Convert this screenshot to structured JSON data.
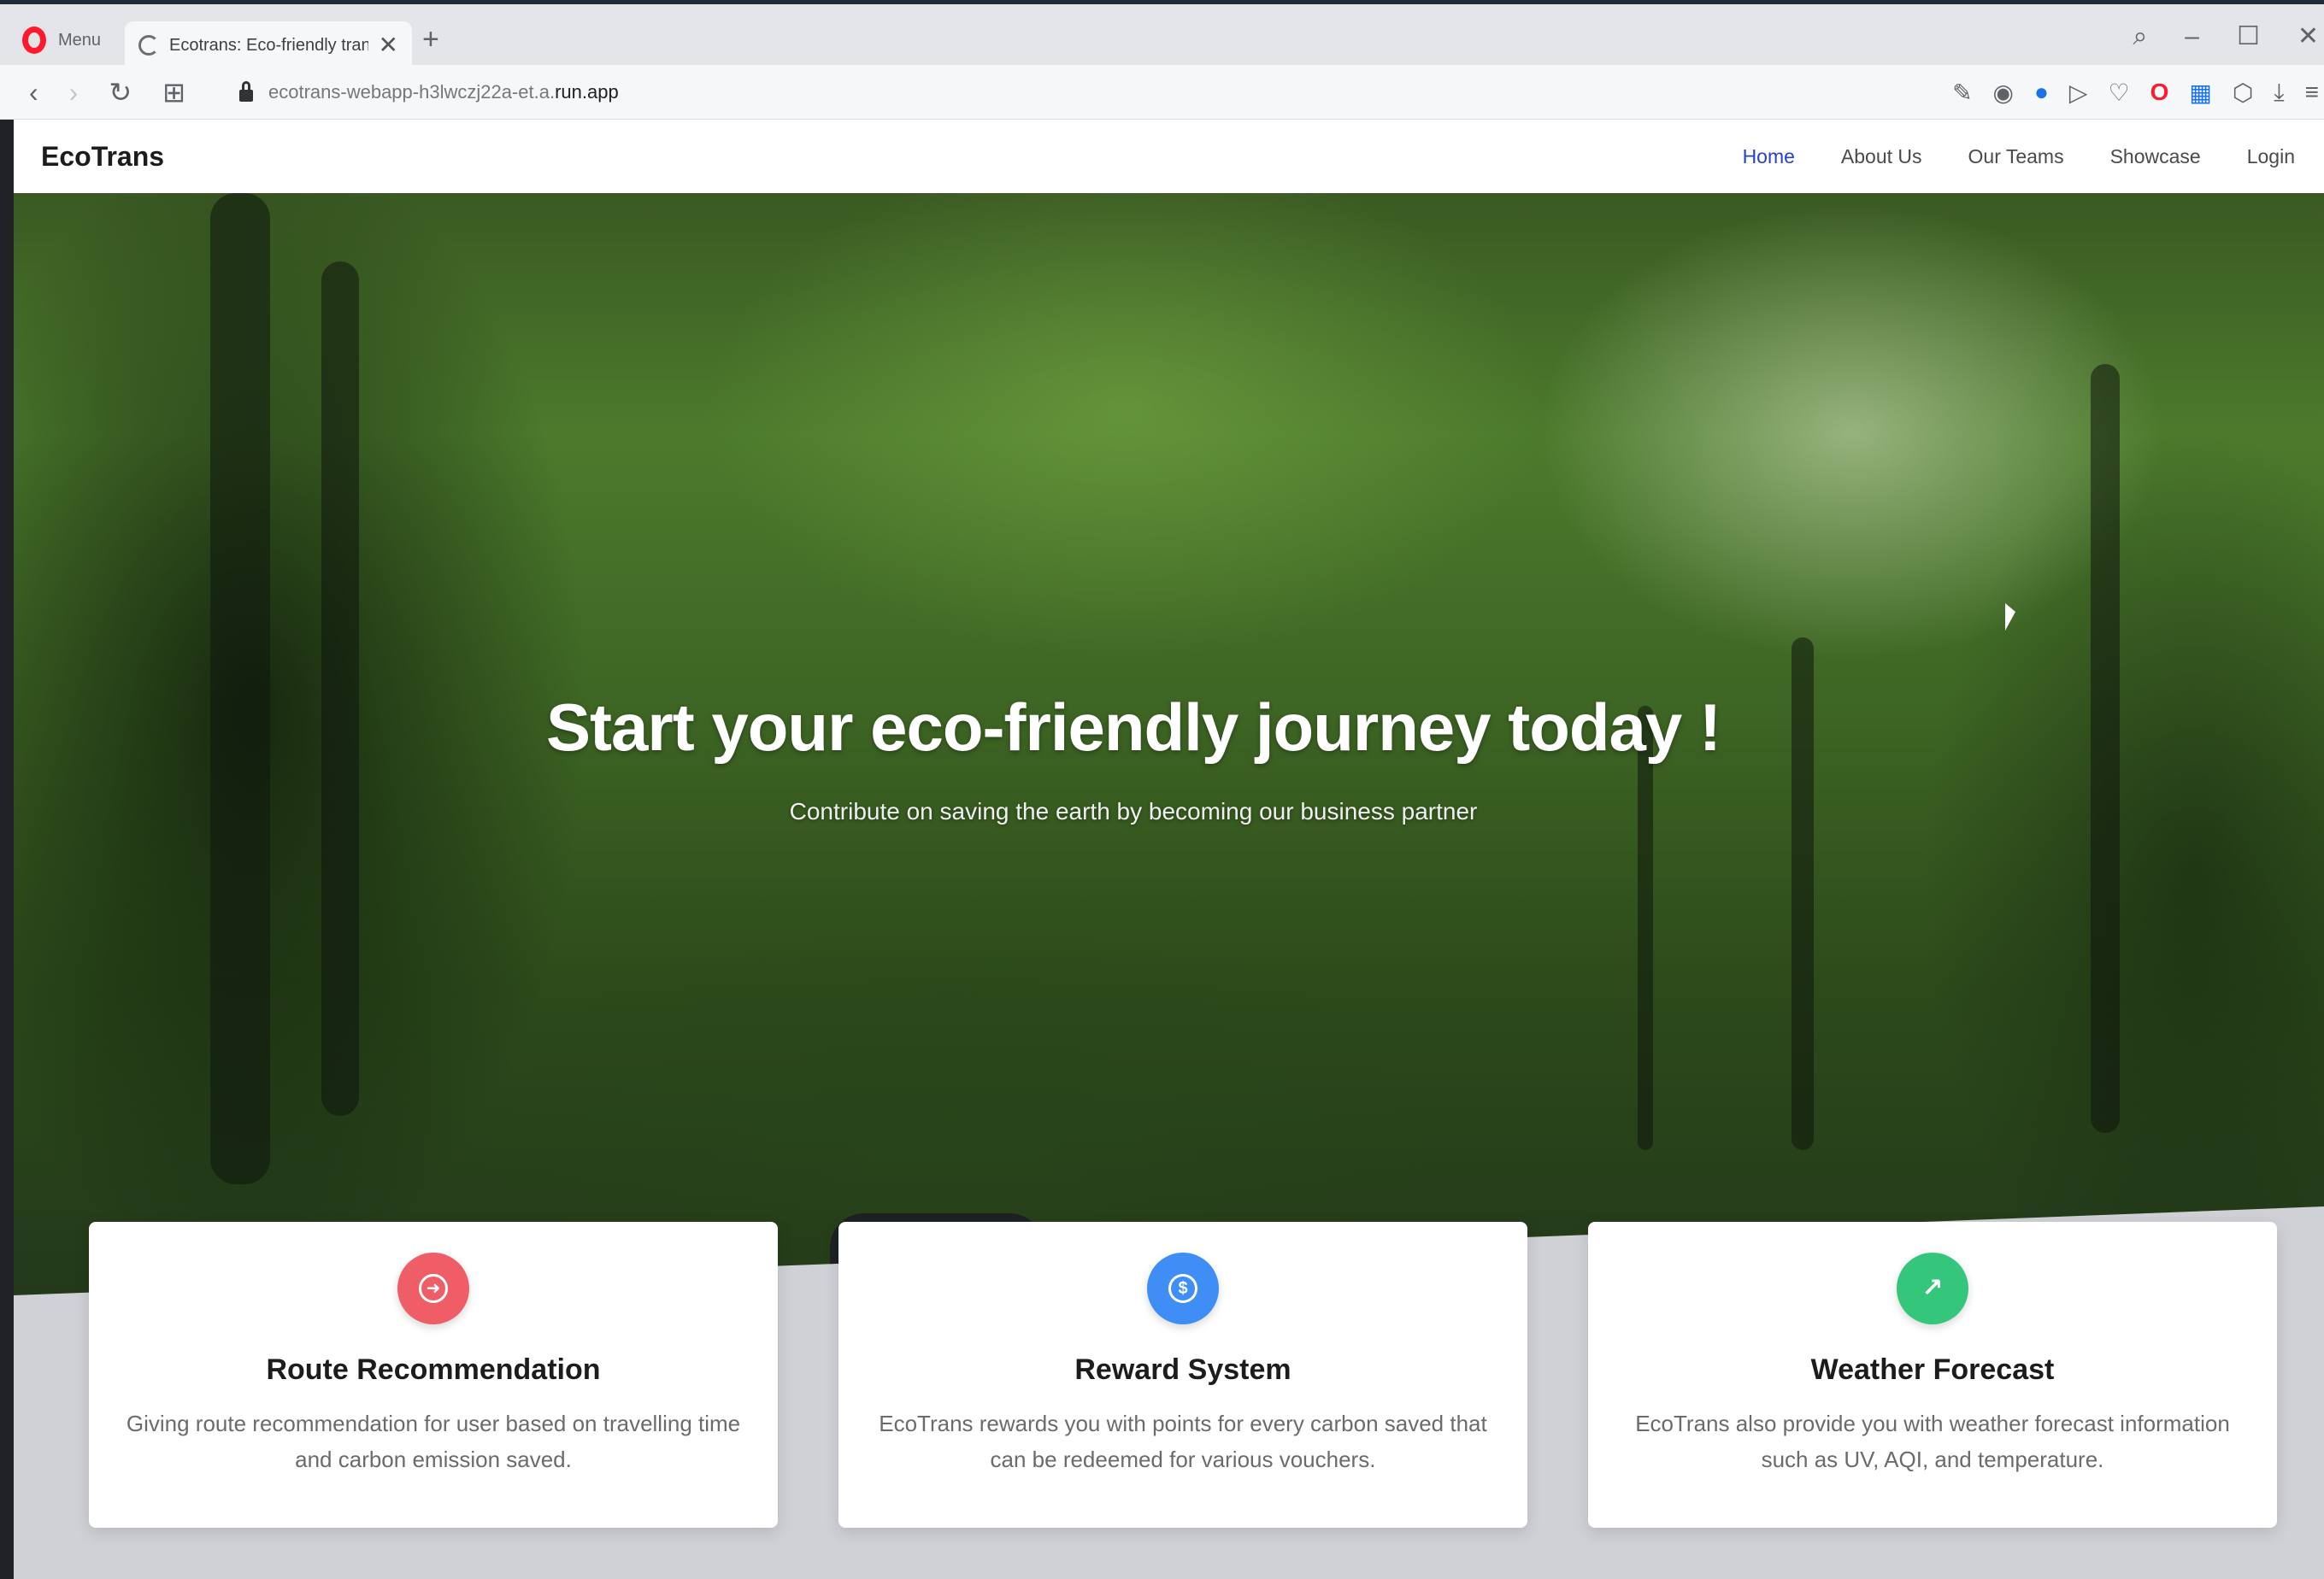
{
  "browser": {
    "menu_label": "Menu",
    "tab_title": "Ecotrans: Eco-friendly tran",
    "tab_close": "✕",
    "new_tab": "+",
    "url_path": "ecotrans-webapp-h3lwczj22a-et.a.",
    "url_host": "run.app",
    "window_controls": {
      "search": "⌕",
      "minimize": "–",
      "maximize": "☐",
      "close": "✕"
    },
    "nav": {
      "back": "‹",
      "forward": "›",
      "reload": "↻",
      "tabs": "⊞"
    },
    "extensions": [
      "✎",
      "◉",
      "●",
      "▷",
      "♡",
      "O",
      "▦",
      "⬡",
      "⤓",
      "≡"
    ]
  },
  "site": {
    "brand": "EcoTrans",
    "nav": [
      {
        "label": "Home",
        "active": true
      },
      {
        "label": "About Us",
        "active": false
      },
      {
        "label": "Our Teams",
        "active": false
      },
      {
        "label": "Showcase",
        "active": false
      },
      {
        "label": "Login",
        "active": false
      }
    ],
    "hero": {
      "title": "Start your eco-friendly journey today !",
      "subtitle": "Contribute on saving the earth by becoming our business partner"
    },
    "features": [
      {
        "icon": "route-icon",
        "icon_color": "#ef5e66",
        "title": "Route Recommendation",
        "description": "Giving route recommendation for user based on travelling time and carbon emission saved."
      },
      {
        "icon": "dollar-icon",
        "icon_color": "#3f8ef5",
        "title": "Reward System",
        "description": "EcoTrans rewards you with points for every carbon saved that can be redeemed for various vouchers."
      },
      {
        "icon": "trending-up-icon",
        "icon_color": "#34c77b",
        "title": "Weather Forecast",
        "description": "EcoTrans also provide you with weather forecast information such as UV, AQI, and temperature."
      }
    ]
  },
  "colors": {
    "nav_active": "#2742c7",
    "page_bg": "#cfd1d6",
    "opera_red": "#ff1b2d"
  }
}
